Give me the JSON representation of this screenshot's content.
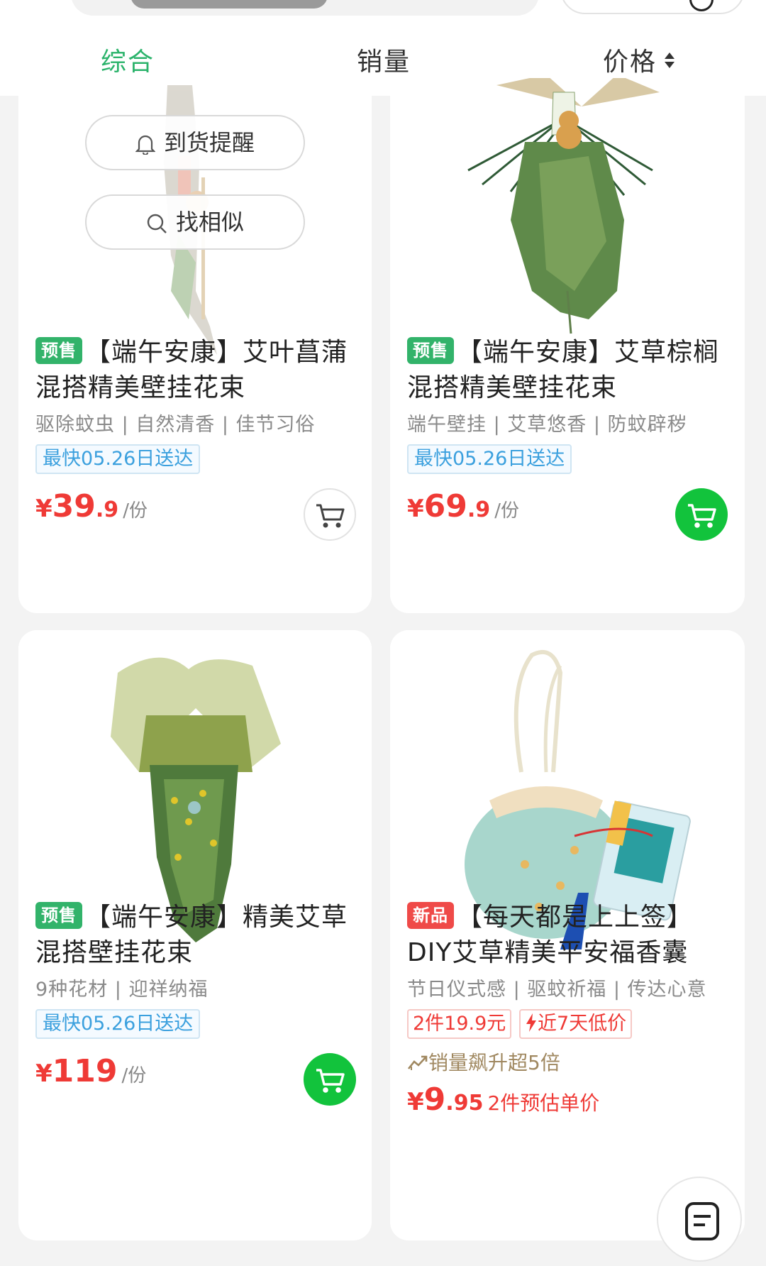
{
  "tabs": {
    "zonghe": "综合",
    "xiaoliang": "销量",
    "price": "价格"
  },
  "overlay": {
    "notify": "到货提醒",
    "similar": "找相似"
  },
  "products": [
    {
      "badge": "预售",
      "title": "【端午安康】艾叶菖蒲混搭精美壁挂花束",
      "subtitle": "驱除蚊虫 | 自然清香 | 佳节习俗",
      "delivery": "最快05.26日送达",
      "yen": "¥",
      "price_int": "39",
      "price_dec": ".9",
      "unit": "/份"
    },
    {
      "badge": "预售",
      "title": "【端午安康】艾草棕榈混搭精美壁挂花束",
      "subtitle": "端午壁挂 | 艾草悠香 | 防蚊辟秽",
      "delivery": "最快05.26日送达",
      "yen": "¥",
      "price_int": "69",
      "price_dec": ".9",
      "unit": "/份"
    },
    {
      "badge": "预售",
      "title": "【端午安康】精美艾草混搭壁挂花束",
      "subtitle": "9种花材 | 迎祥纳福",
      "delivery": "最快05.26日送达",
      "yen": "¥",
      "price_int": "119",
      "price_dec": "",
      "unit": "/份"
    },
    {
      "badge": "新品",
      "title": "【每天都是上上签】DIY艾草精美平安福香囊",
      "subtitle": "节日仪式感 | 驱蚊祈福 | 传达心意",
      "promo1": "2件19.9元",
      "promo2": "近7天低价",
      "sales_up": "销量飙升超5倍",
      "yen": "¥",
      "price_int": "9",
      "price_dec": ".95",
      "note": "2件预估单价"
    }
  ],
  "colors": {
    "accent_green": "#2bb36b",
    "price_red": "#ef3a36",
    "cart_green": "#12c33c",
    "delivery_blue": "#3ba0de"
  }
}
